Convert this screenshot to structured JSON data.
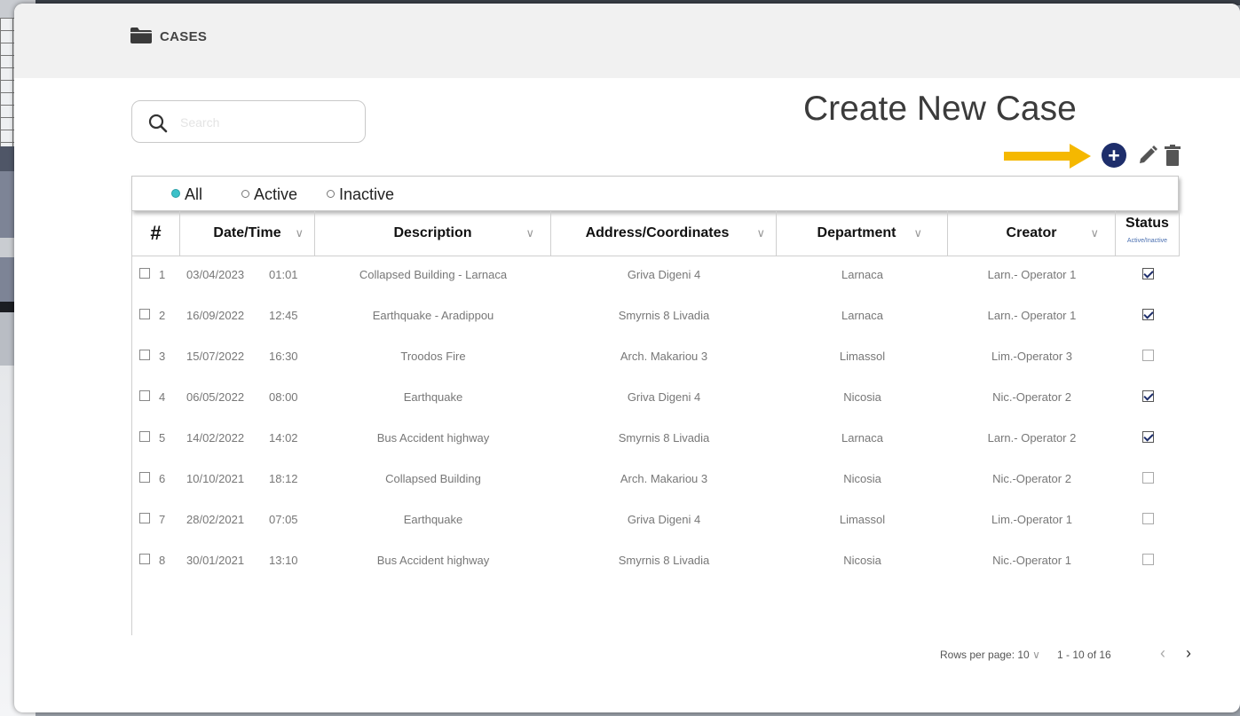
{
  "header": {
    "title": "CASES"
  },
  "search": {
    "placeholder": "Search"
  },
  "callout": {
    "text": "Create New Case"
  },
  "filters": [
    {
      "label": "All",
      "selected": true
    },
    {
      "label": "Active",
      "selected": false
    },
    {
      "label": "Inactive",
      "selected": false
    }
  ],
  "columns": {
    "num": "#",
    "datetime": "Date/Time",
    "description": "Description",
    "address": "Address/Coordinates",
    "department": "Department",
    "creator": "Creator",
    "status": "Status",
    "status_sub": "Active/Inactive"
  },
  "rows": [
    {
      "num": "1",
      "date": "03/04/2023",
      "time": "01:01",
      "description": "Collapsed Building - Larnaca",
      "address": "Griva Digeni 4",
      "department": "Larnaca",
      "creator": "Larn.- Operator 1",
      "active": true
    },
    {
      "num": "2",
      "date": "16/09/2022",
      "time": "12:45",
      "description": "Earthquake - Aradippou",
      "address": "Smyrnis 8 Livadia",
      "department": "Larnaca",
      "creator": "Larn.- Operator 1",
      "active": true
    },
    {
      "num": "3",
      "date": "15/07/2022",
      "time": "16:30",
      "description": "Troodos Fire",
      "address": "Arch. Makariou 3",
      "department": "Limassol",
      "creator": "Lim.-Operator 3",
      "active": false
    },
    {
      "num": "4",
      "date": "06/05/2022",
      "time": "08:00",
      "description": "Earthquake",
      "address": "Griva Digeni 4",
      "department": "Nicosia",
      "creator": "Nic.-Operator 2",
      "active": true
    },
    {
      "num": "5",
      "date": "14/02/2022",
      "time": "14:02",
      "description": "Bus Accident highway",
      "address": "Smyrnis 8 Livadia",
      "department": "Larnaca",
      "creator": "Larn.- Operator 2",
      "active": true
    },
    {
      "num": "6",
      "date": "10/10/2021",
      "time": "18:12",
      "description": "Collapsed Building",
      "address": "Arch. Makariou 3",
      "department": "Nicosia",
      "creator": "Nic.-Operator 2",
      "active": false
    },
    {
      "num": "7",
      "date": "28/02/2021",
      "time": "07:05",
      "description": "Earthquake",
      "address": "Griva Digeni 4",
      "department": "Limassol",
      "creator": "Lim.-Operator 1",
      "active": false
    },
    {
      "num": "8",
      "date": "30/01/2021",
      "time": "13:10",
      "description": "Bus Accident highway",
      "address": "Smyrnis 8 Livadia",
      "department": "Nicosia",
      "creator": "Nic.-Operator 1",
      "active": false
    }
  ],
  "pagination": {
    "rows_per_page_label": "Rows per page: 10",
    "range": "1 - 10 of 16",
    "prev": "‹",
    "next": "›"
  },
  "icons": {
    "folder": "folder-icon",
    "search": "search-icon",
    "add": "plus-circle-icon",
    "edit": "pencil-icon",
    "delete": "trash-icon",
    "arrow": "arrow-right-icon"
  },
  "colors": {
    "accent": "#1e2e6b",
    "arrow": "#f5b800",
    "radio_selected": "#3cc1c9",
    "status_sub": "#4a6fb0"
  }
}
